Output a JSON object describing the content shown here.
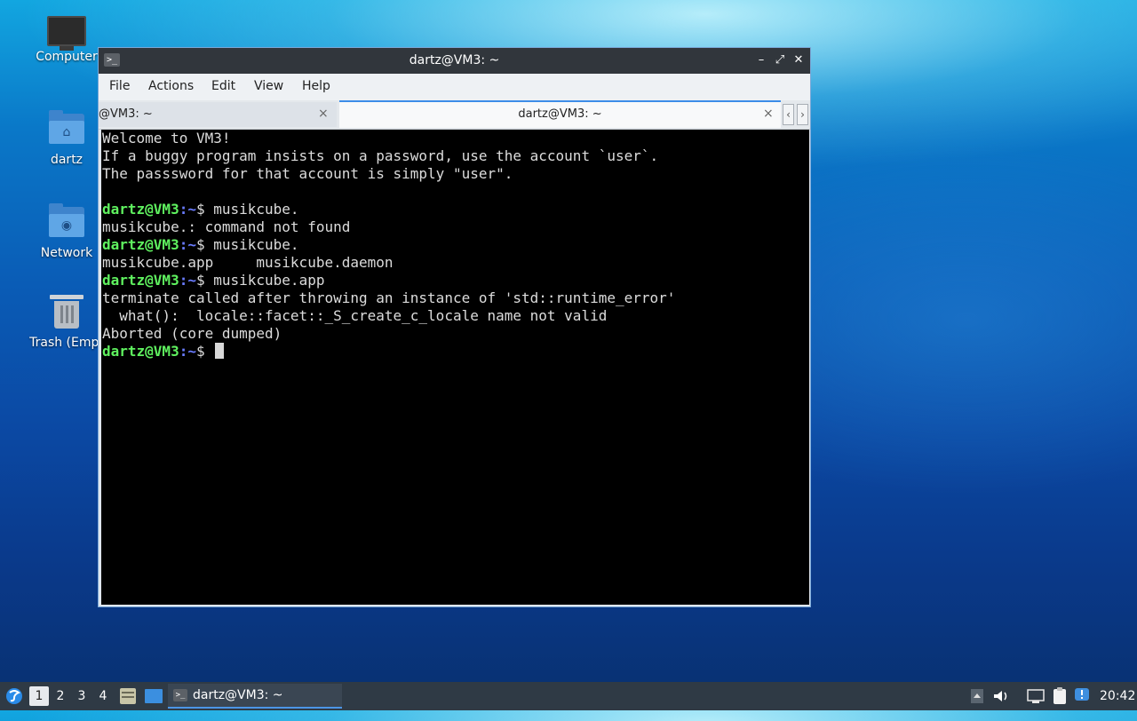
{
  "desktop": {
    "icons": [
      {
        "label": "Computer",
        "icon": "computer-icon"
      },
      {
        "label": "dartz",
        "icon": "home-folder-icon"
      },
      {
        "label": "Network",
        "icon": "network-folder-icon"
      },
      {
        "label": "Trash (Empt",
        "icon": "trash-icon"
      }
    ]
  },
  "window": {
    "title": "dartz@VM3: ~",
    "icon_glyph": ">_",
    "buttons": {
      "minimize": "–",
      "maximize": "⤢",
      "close": "✕"
    }
  },
  "menubar": {
    "items": [
      "File",
      "Actions",
      "Edit",
      "View",
      "Help"
    ]
  },
  "tabs": {
    "items": [
      {
        "label": "@VM3: ~",
        "close": "×",
        "active": false
      },
      {
        "label": "dartz@VM3: ~",
        "close": "×",
        "active": true
      }
    ],
    "scroll_left": "‹",
    "scroll_right": "›"
  },
  "terminal": {
    "prompt_user": "dartz@VM3",
    "prompt_path": ":~",
    "prompt_symbol": "$ ",
    "lines": [
      "Welcome to VM3!",
      "If a buggy program insists on a password, use the account `user`.",
      "The passsword for that account is simply \"user\".",
      "",
      "musikcube.",
      "musikcube.: command not found",
      "musikcube.",
      "musikcube.app     musikcube.daemon",
      "musikcube.app",
      "terminate called after throwing an instance of 'std::runtime_error'",
      "  what():  locale::facet::_S_create_c_locale name not valid",
      "Aborted (core dumped)",
      ""
    ]
  },
  "taskbar": {
    "workspaces": [
      "1",
      "2",
      "3",
      "4"
    ],
    "active_workspace": "1",
    "task_label": "dartz@VM3: ~",
    "clock": "20:42"
  }
}
